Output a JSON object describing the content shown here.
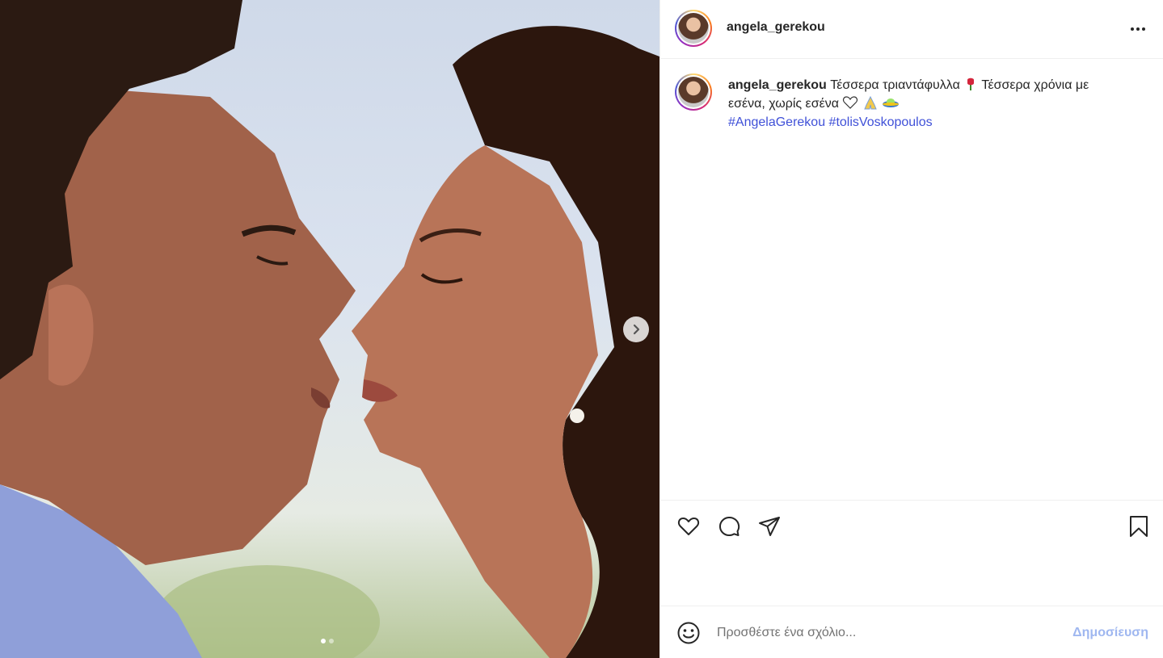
{
  "post": {
    "username": "angela_gerekou",
    "caption_text": "Τέσσερα τριαντάφυλλα",
    "caption_text_2": "Τέσσερα χρόνια με",
    "caption_text_3": "εσένα, χωρίς εσένα",
    "hashtags": [
      "#AngelaGerekou",
      "#tolisVoskopoulos"
    ],
    "emojis": [
      "rose-emoji",
      "white-heart-emoji",
      "folded-hands-emoji",
      "flying-saucer-emoji"
    ]
  },
  "carousel": {
    "total_slides": 2,
    "current_slide": 1
  },
  "icons": {
    "more": "more-options-icon",
    "next": "chevron-right-icon",
    "like": "heart-icon",
    "comment": "comment-icon",
    "share": "share-icon",
    "save": "bookmark-icon",
    "emoji": "smiley-icon"
  },
  "comment_box": {
    "placeholder": "Προσθέστε ένα σχόλιο...",
    "post_label": "Δημοσίευση"
  },
  "colors": {
    "hashtag": "#4051d8",
    "post_button": "#9fb7f0",
    "border": "#efefef"
  }
}
